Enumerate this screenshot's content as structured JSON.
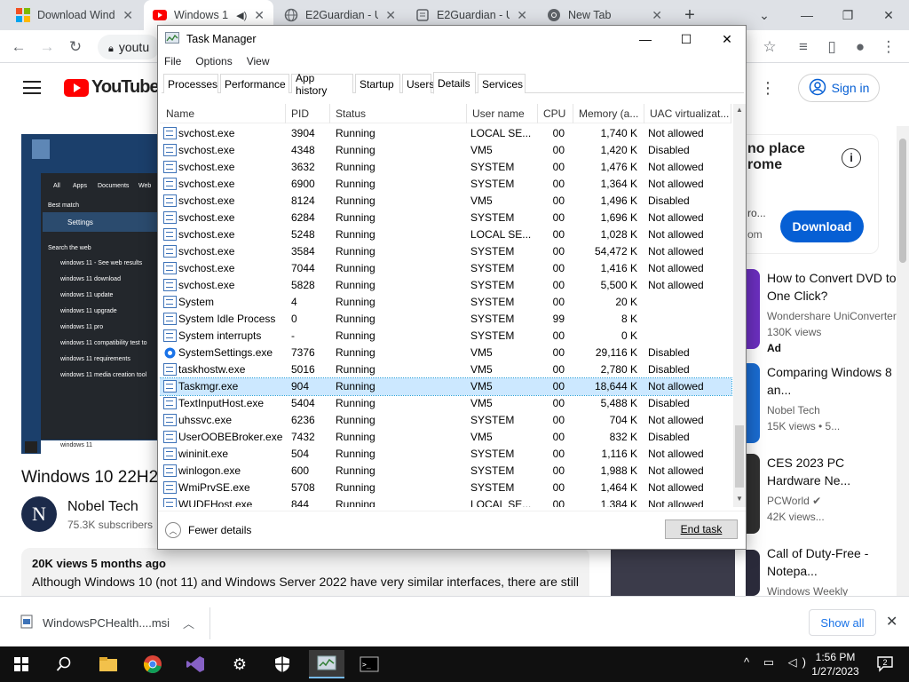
{
  "browser": {
    "tabs": [
      {
        "title": "Download Wind",
        "icon": "windows-logo-icon"
      },
      {
        "title": "Windows 1",
        "icon": "youtube-icon",
        "active": true
      },
      {
        "title": "E2Guardian - Ur",
        "icon": "globe-icon"
      },
      {
        "title": "E2Guardian - Ur",
        "icon": "page-icon"
      },
      {
        "title": "New Tab",
        "icon": "chrome-icon"
      }
    ],
    "new_tab": "+",
    "url": "youtu"
  },
  "youtube": {
    "logo_text": "YouTube",
    "signin": "Sign in",
    "video_title": "Windows 10 22H2",
    "channel_avatar": "N",
    "channel_name": "Nobel Tech",
    "subscribers": "75.3K subscribers",
    "desc_meta": "20K views  5 months ago",
    "desc_text": "Although Windows 10 (not 11) and Windows Server 2022 have very similar interfaces, there are still",
    "ad_headline_line1": "no place",
    "ad_headline_line2": "rome",
    "ad_fragment1": "ro...",
    "ad_fragment2": "om",
    "ad_button": "Download",
    "start_menu_lines": [
      "All",
      "Apps",
      "Documents",
      "Web",
      "Best match",
      "Settings",
      "Search the web",
      "windows 11 - See web results",
      "windows 11 download",
      "windows 11 update",
      "windows 11 upgrade",
      "windows 11 pro",
      "windows 11 compatibility test to",
      "windows 11 requirements",
      "windows 11 media creation tool"
    ],
    "start_search_text": "windows 11",
    "recommendations": [
      {
        "title": "How to Convert DVD to One Click?",
        "meta1": "Wondershare UniConverter",
        "meta2": "130K views",
        "meta3": "Ad",
        "thumb_color": "#6b2fbf"
      },
      {
        "title": "Comparing Windows 8 an...",
        "meta1": "Nobel Tech",
        "meta2": "15K views • 5...",
        "thumb_color": "#1a6bd0"
      },
      {
        "title": "CES 2023 PC Hardware Ne...",
        "meta1": "PCWorld ✔",
        "meta2": "42K views...",
        "thumb_color": "#303030"
      },
      {
        "title": "Call of Duty-Free - Notepa...",
        "meta1": "Windows Weekly",
        "thumb_color": "#2a2a3a"
      }
    ]
  },
  "downloads": {
    "file": "WindowsPCHealth....msi",
    "show_all": "Show all"
  },
  "taskbar": {
    "time": "1:56 PM",
    "date": "1/27/2023",
    "notifications": "2"
  },
  "taskmanager": {
    "title": "Task Manager",
    "menu": [
      "File",
      "Options",
      "View"
    ],
    "tabs": [
      "Processes",
      "Performance",
      "App history",
      "Startup",
      "Users",
      "Details",
      "Services"
    ],
    "active_tab": "Details",
    "columns": [
      "Name",
      "PID",
      "Status",
      "User name",
      "CPU",
      "Memory (a...",
      "UAC virtualizat..."
    ],
    "rows": [
      [
        "svchost.exe",
        "3904",
        "Running",
        "LOCAL SE...",
        "00",
        "1,740 K",
        "Not allowed"
      ],
      [
        "svchost.exe",
        "4348",
        "Running",
        "VM5",
        "00",
        "1,420 K",
        "Disabled"
      ],
      [
        "svchost.exe",
        "3632",
        "Running",
        "SYSTEM",
        "00",
        "1,476 K",
        "Not allowed"
      ],
      [
        "svchost.exe",
        "6900",
        "Running",
        "SYSTEM",
        "00",
        "1,364 K",
        "Not allowed"
      ],
      [
        "svchost.exe",
        "8124",
        "Running",
        "VM5",
        "00",
        "1,496 K",
        "Disabled"
      ],
      [
        "svchost.exe",
        "6284",
        "Running",
        "SYSTEM",
        "00",
        "1,696 K",
        "Not allowed"
      ],
      [
        "svchost.exe",
        "5248",
        "Running",
        "LOCAL SE...",
        "00",
        "1,028 K",
        "Not allowed"
      ],
      [
        "svchost.exe",
        "3584",
        "Running",
        "SYSTEM",
        "00",
        "54,472 K",
        "Not allowed"
      ],
      [
        "svchost.exe",
        "7044",
        "Running",
        "SYSTEM",
        "00",
        "1,416 K",
        "Not allowed"
      ],
      [
        "svchost.exe",
        "5828",
        "Running",
        "SYSTEM",
        "00",
        "5,500 K",
        "Not allowed"
      ],
      [
        "System",
        "4",
        "Running",
        "SYSTEM",
        "00",
        "20 K",
        ""
      ],
      [
        "System Idle Process",
        "0",
        "Running",
        "SYSTEM",
        "99",
        "8 K",
        ""
      ],
      [
        "System interrupts",
        "-",
        "Running",
        "SYSTEM",
        "00",
        "0 K",
        ""
      ],
      [
        "SystemSettings.exe",
        "7376",
        "Running",
        "VM5",
        "00",
        "29,116 K",
        "Disabled"
      ],
      [
        "taskhostw.exe",
        "5016",
        "Running",
        "VM5",
        "00",
        "2,780 K",
        "Disabled"
      ],
      [
        "Taskmgr.exe",
        "904",
        "Running",
        "VM5",
        "00",
        "18,644 K",
        "Not allowed"
      ],
      [
        "TextInputHost.exe",
        "5404",
        "Running",
        "VM5",
        "00",
        "5,488 K",
        "Disabled"
      ],
      [
        "uhssvc.exe",
        "6236",
        "Running",
        "SYSTEM",
        "00",
        "704 K",
        "Not allowed"
      ],
      [
        "UserOOBEBroker.exe",
        "7432",
        "Running",
        "VM5",
        "00",
        "832 K",
        "Disabled"
      ],
      [
        "wininit.exe",
        "504",
        "Running",
        "SYSTEM",
        "00",
        "1,116 K",
        "Not allowed"
      ],
      [
        "winlogon.exe",
        "600",
        "Running",
        "SYSTEM",
        "00",
        "1,988 K",
        "Not allowed"
      ],
      [
        "WmiPrvSE.exe",
        "5708",
        "Running",
        "SYSTEM",
        "00",
        "1,464 K",
        "Not allowed"
      ],
      [
        "WUDFHost.exe",
        "844",
        "Running",
        "LOCAL SE...",
        "00",
        "1,384 K",
        "Not allowed"
      ]
    ],
    "selected_row": 15,
    "gear_row": 13,
    "fewer_details": "Fewer details",
    "end_task": "End task"
  }
}
